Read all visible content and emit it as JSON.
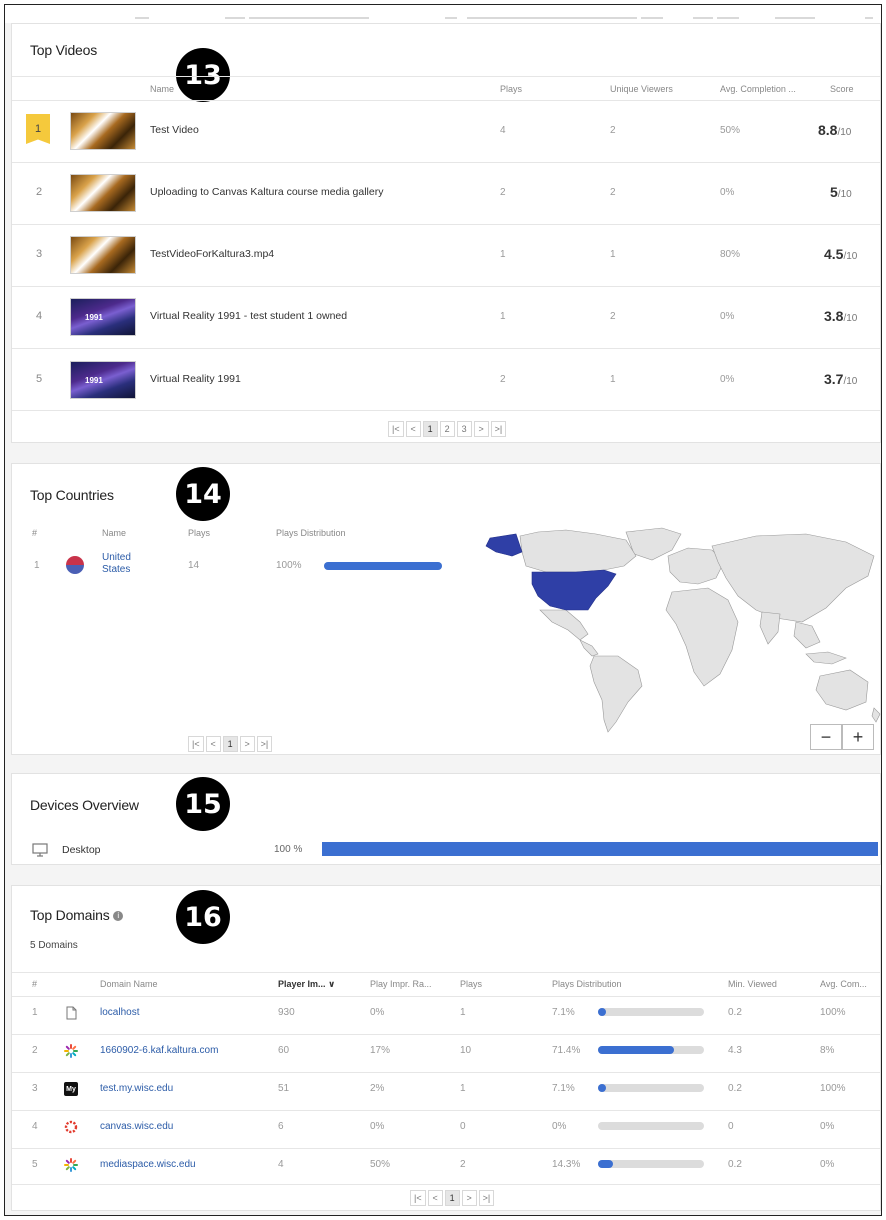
{
  "top_videos": {
    "title": "Top Videos",
    "callout": "13",
    "columns": [
      "Name",
      "Plays",
      "Unique Viewers",
      "Avg. Completion ...",
      "Score"
    ],
    "rows": [
      {
        "rank": "1",
        "name": "Test Video",
        "plays": "4",
        "unique": "2",
        "completion": "50%",
        "score": "8.8",
        "score_suffix": "/10",
        "thumb": "gold"
      },
      {
        "rank": "2",
        "name": "Uploading to Canvas Kaltura course media gallery",
        "plays": "2",
        "unique": "2",
        "completion": "0%",
        "score": "5",
        "score_suffix": "/10",
        "thumb": "gold"
      },
      {
        "rank": "3",
        "name": "TestVideoForKaltura3.mp4",
        "plays": "1",
        "unique": "1",
        "completion": "80%",
        "score": "4.5",
        "score_suffix": "/10",
        "thumb": "gold"
      },
      {
        "rank": "4",
        "name": "Virtual Reality 1991 - test student 1 owned",
        "plays": "1",
        "unique": "2",
        "completion": "0%",
        "score": "3.8",
        "score_suffix": "/10",
        "thumb": "vr"
      },
      {
        "rank": "5",
        "name": "Virtual Reality 1991",
        "plays": "2",
        "unique": "1",
        "completion": "0%",
        "score": "3.7",
        "score_suffix": "/10",
        "thumb": "vr"
      }
    ],
    "pager": [
      "|<",
      "<",
      "1",
      "2",
      "3",
      ">",
      ">|"
    ]
  },
  "top_countries": {
    "title": "Top Countries",
    "callout": "14",
    "columns": [
      "#",
      "Name",
      "Plays",
      "Plays Distribution"
    ],
    "rows": [
      {
        "rank": "1",
        "name_line1": "United",
        "name_line2": "States",
        "plays": "14",
        "pct": "100%",
        "fraction": 1.0
      }
    ],
    "pager": [
      "|<",
      "<",
      "1",
      ">",
      ">|"
    ],
    "zoom_out": "−",
    "zoom_in": "+",
    "highlight_color": "#2f3fa6"
  },
  "devices": {
    "title": "Devices Overview",
    "callout": "15",
    "rows": [
      {
        "name": "Desktop",
        "pct": "100 %",
        "fraction": 1.0
      }
    ]
  },
  "top_domains": {
    "title": "Top Domains",
    "callout": "16",
    "subtitle": "5 Domains",
    "columns": [
      "#",
      "Domain Name",
      "Player Im...",
      "Play Impr. Ra...",
      "Plays",
      "Plays Distribution",
      "Min. Viewed",
      "Avg. Com..."
    ],
    "rows": [
      {
        "rank": "1",
        "icon": "file-icon",
        "domain": "localhost",
        "impr": "930",
        "impr_rate": "0%",
        "plays": "1",
        "dist": "7.1%",
        "fraction": 0.071,
        "min": "0.2",
        "avg": "100%"
      },
      {
        "rank": "2",
        "icon": "kaltura-icon",
        "domain": "1660902-6.kaf.kaltura.com",
        "impr": "60",
        "impr_rate": "17%",
        "plays": "10",
        "dist": "71.4%",
        "fraction": 0.714,
        "min": "4.3",
        "avg": "8%"
      },
      {
        "rank": "3",
        "icon": "my-icon",
        "domain": "test.my.wisc.edu",
        "impr": "51",
        "impr_rate": "2%",
        "plays": "1",
        "dist": "7.1%",
        "fraction": 0.071,
        "min": "0.2",
        "avg": "100%"
      },
      {
        "rank": "4",
        "icon": "canvas-icon",
        "domain": "canvas.wisc.edu",
        "impr": "6",
        "impr_rate": "0%",
        "plays": "0",
        "dist": "0%",
        "fraction": 0.0,
        "min": "0",
        "avg": "0%"
      },
      {
        "rank": "5",
        "icon": "kaltura-icon",
        "domain": "mediaspace.wisc.edu",
        "impr": "4",
        "impr_rate": "50%",
        "plays": "2",
        "dist": "14.3%",
        "fraction": 0.143,
        "min": "0.2",
        "avg": "0%"
      }
    ],
    "pager": [
      "|<",
      "<",
      "1",
      ">",
      ">|"
    ],
    "accent": "#3b6fd1"
  }
}
